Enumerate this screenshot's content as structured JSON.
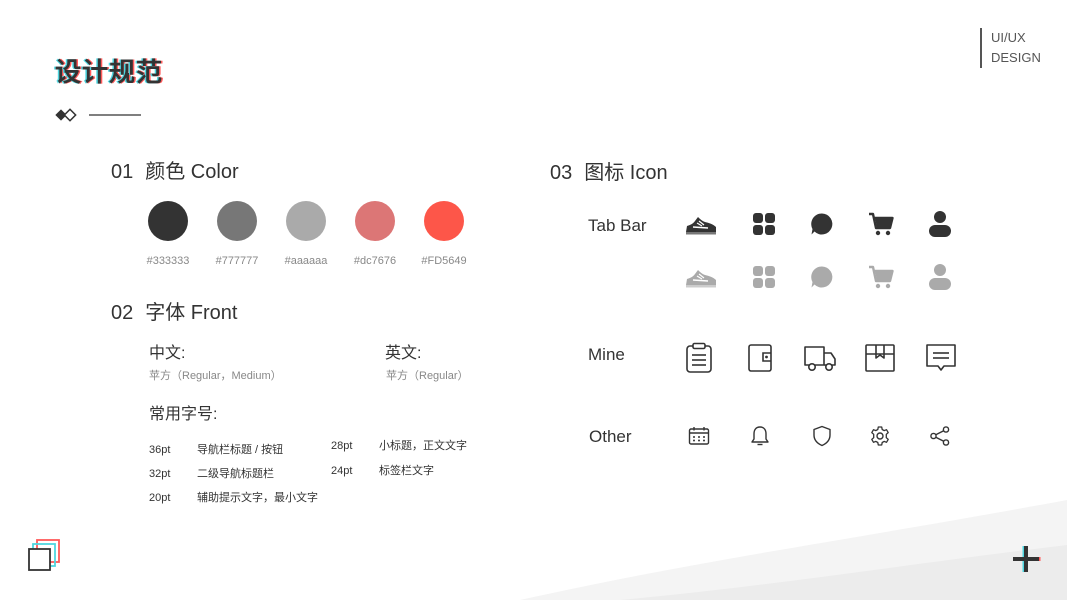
{
  "page": {
    "title": "设计规范",
    "corner_label_1": "UI/UX",
    "corner_label_2": "DESIGN"
  },
  "color_section": {
    "num": "01",
    "title": "颜色 Color",
    "swatches": [
      {
        "hex": "#333333",
        "color": "#333333"
      },
      {
        "hex": "#777777",
        "color": "#777777"
      },
      {
        "hex": "#aaaaaa",
        "color": "#aaaaaa"
      },
      {
        "hex": "#dc7676",
        "color": "#dc7676"
      },
      {
        "hex": "#FD5649",
        "color": "#FD5649"
      }
    ]
  },
  "font_section": {
    "num": "02",
    "title": "字体 Front",
    "chinese_label": "中文:",
    "chinese_font": "苹方（Regular，Medium）",
    "english_label": "英文:",
    "english_font": "苹方（Regular）",
    "common_sizes_label": "常用字号:",
    "sizes": [
      {
        "pt": "36pt",
        "desc": "导航栏标题 / 按钮"
      },
      {
        "pt": "32pt",
        "desc": "二级导航标题栏"
      },
      {
        "pt": "20pt",
        "desc": "辅助提示文字，最小文字"
      },
      {
        "pt": "28pt",
        "desc": "小标题，正文文字"
      },
      {
        "pt": "24pt",
        "desc": "标签栏文字"
      }
    ]
  },
  "icon_section": {
    "num": "03",
    "title": "图标 Icon",
    "rows": {
      "tab_bar": "Tab Bar",
      "mine": "Mine",
      "other": "Other"
    },
    "icons": {
      "tab_bar": [
        "shoe-icon",
        "apps-grid-icon",
        "chat-bubble-icon",
        "shopping-cart-icon",
        "user-icon"
      ],
      "mine": [
        "clipboard-icon",
        "wallet-icon",
        "delivery-truck-icon",
        "package-box-icon",
        "message-icon"
      ],
      "other": [
        "calendar-icon",
        "bell-icon",
        "shield-icon",
        "settings-gear-icon",
        "share-icon"
      ]
    },
    "active_color": "#333333",
    "inactive_color": "#aaaaaa"
  },
  "accents": {
    "cyan": "#4fd6e0",
    "red": "#ff5a5a"
  }
}
